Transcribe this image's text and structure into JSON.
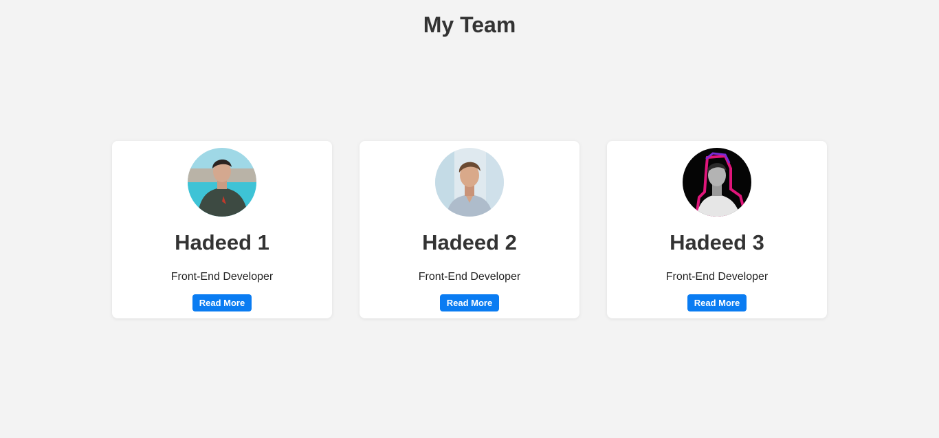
{
  "page": {
    "title": "My Team"
  },
  "colors": {
    "background": "#f3f3f3",
    "card": "#ffffff",
    "button": "#0a7cf2",
    "text": "#333333"
  },
  "members": [
    {
      "name": "Hadeed 1",
      "role": "Front-End Developer",
      "button_label": "Read More",
      "avatar": "avatar-photo-pool-background"
    },
    {
      "name": "Hadeed 2",
      "role": "Front-End Developer",
      "button_label": "Read More",
      "avatar": "avatar-photo-light-background"
    },
    {
      "name": "Hadeed 3",
      "role": "Front-End Developer",
      "button_label": "Read More",
      "avatar": "avatar-photo-black-background-neon-outline"
    }
  ]
}
